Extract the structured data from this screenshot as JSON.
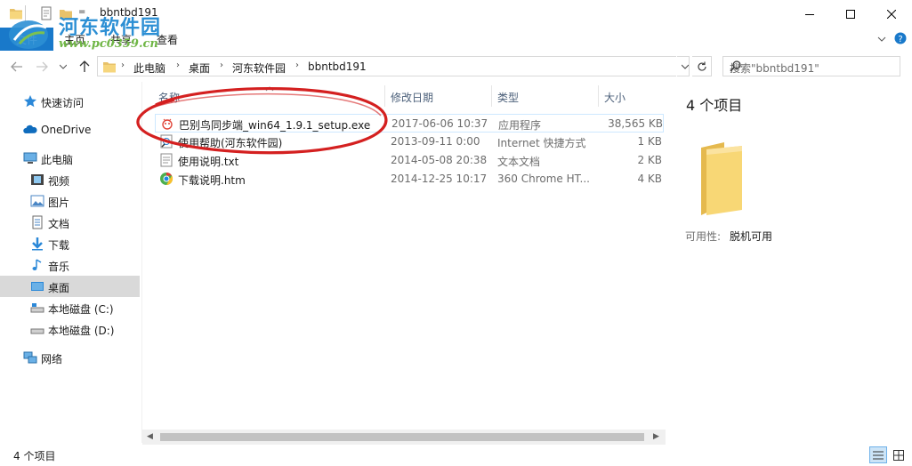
{
  "window": {
    "title": "bbntbd191",
    "controls": {
      "minimize_icon": "minimize-icon",
      "maximize_icon": "maximize-icon",
      "close_icon": "close-icon"
    }
  },
  "watermark": {
    "title": "河东软件园",
    "url": "www.pc0359.cn"
  },
  "ribbon": {
    "file_tab": "文件",
    "tabs": [
      "主页",
      "共享",
      "查看"
    ]
  },
  "address": {
    "crumbs": [
      "此电脑",
      "桌面",
      "河东软件园",
      "bbntbd191"
    ],
    "search_placeholder": "搜索\"bbntbd191\""
  },
  "nav": {
    "items": [
      {
        "label": "快速访问",
        "icon": "quick-access-star-icon"
      },
      {
        "label": "OneDrive",
        "icon": "onedrive-cloud-icon"
      },
      {
        "label": "此电脑",
        "icon": "this-pc-icon"
      },
      {
        "label": "视频",
        "icon": "videos-icon"
      },
      {
        "label": "图片",
        "icon": "pictures-icon"
      },
      {
        "label": "文档",
        "icon": "documents-icon"
      },
      {
        "label": "下载",
        "icon": "downloads-icon"
      },
      {
        "label": "音乐",
        "icon": "music-icon"
      },
      {
        "label": "桌面",
        "icon": "desktop-icon",
        "selected": true
      },
      {
        "label": "本地磁盘 (C:)",
        "icon": "drive-c-icon"
      },
      {
        "label": "本地磁盘 (D:)",
        "icon": "drive-d-icon"
      },
      {
        "label": "网络",
        "icon": "network-icon"
      }
    ]
  },
  "columns": {
    "name": "名称",
    "date": "修改日期",
    "type": "类型",
    "size": "大小"
  },
  "files": [
    {
      "name": "巴别鸟同步端_win64_1.9.1_setup.exe",
      "date": "2017-06-06 10:37",
      "type": "应用程序",
      "size": "38,565 KB",
      "icon": "exe-bird-icon"
    },
    {
      "name": "使用帮助(河东软件园)",
      "date": "2013-09-11 0:00",
      "type": "Internet 快捷方式",
      "size": "1 KB",
      "icon": "internet-shortcut-icon"
    },
    {
      "name": "使用说明.txt",
      "date": "2014-05-08 20:38",
      "type": "文本文档",
      "size": "2 KB",
      "icon": "text-file-icon"
    },
    {
      "name": "下载说明.htm",
      "date": "2014-12-25 10:17",
      "type": "360 Chrome HT...",
      "size": "4 KB",
      "icon": "chrome-html-icon"
    }
  ],
  "preview": {
    "count": "4 个项目",
    "availability_label": "可用性:",
    "availability_value": "脱机可用"
  },
  "status": {
    "count": "4 个项目"
  },
  "colors": {
    "accent": "#1979ca",
    "selection": "#cce8ff",
    "annotation": "#d42020"
  }
}
